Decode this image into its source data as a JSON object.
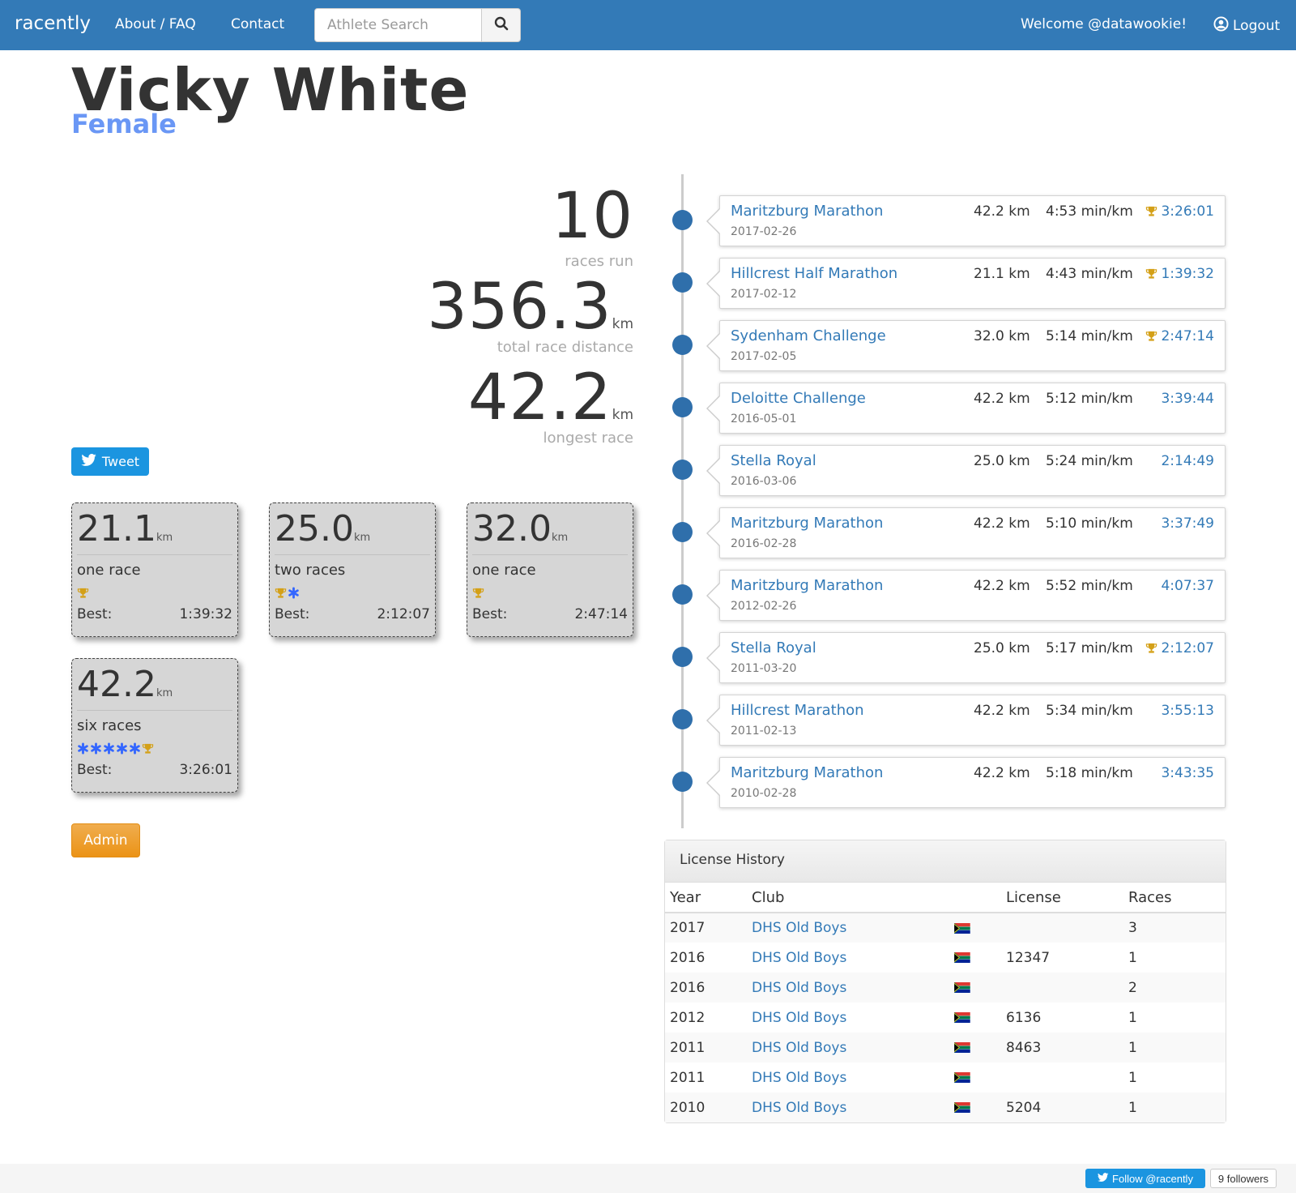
{
  "navbar": {
    "brand": "racently",
    "links": [
      "About / FAQ",
      "Contact"
    ],
    "search": {
      "placeholder": "Athlete Search",
      "button_icon": "search-icon"
    },
    "welcome": "Welcome @datawookie!",
    "logout": "Logout",
    "logout_icon": "user-circle-icon",
    "color": "#337ab7"
  },
  "athlete": {
    "name": "Vicky White",
    "gender": "Female"
  },
  "stats": {
    "races_run": "10",
    "races_run_label": "races run",
    "total_distance": "356.3",
    "total_distance_unit": "km",
    "total_distance_label": "total race distance",
    "longest": "42.2",
    "longest_unit": "km",
    "longest_label": "longest race"
  },
  "tweet_label": "Tweet",
  "distances": [
    {
      "dist": "21.1",
      "unit": "km",
      "count": "one race",
      "icons": [
        "trophy-icon"
      ],
      "best_label": "Best:",
      "best": "1:39:32"
    },
    {
      "dist": "25.0",
      "unit": "km",
      "count": "two races",
      "icons": [
        "trophy-icon",
        "asterisk-icon"
      ],
      "best_label": "Best:",
      "best": "2:12:07"
    },
    {
      "dist": "32.0",
      "unit": "km",
      "count": "one race",
      "icons": [
        "trophy-icon"
      ],
      "best_label": "Best:",
      "best": "2:47:14"
    },
    {
      "dist": "42.2",
      "unit": "km",
      "count": "six races",
      "icons": [
        "asterisk-icon",
        "asterisk-icon",
        "asterisk-icon",
        "asterisk-icon",
        "asterisk-icon",
        "trophy-icon"
      ],
      "best_label": "Best:",
      "best": "3:26:01"
    }
  ],
  "admin_label": "Admin",
  "races": [
    {
      "name": "Maritzburg Marathon",
      "date": "2017-02-26",
      "distance": "42.2 km",
      "pace": "4:53 min/km",
      "time": "3:26:01",
      "trophy": true
    },
    {
      "name": "Hillcrest Half Marathon",
      "date": "2017-02-12",
      "distance": "21.1 km",
      "pace": "4:43 min/km",
      "time": "1:39:32",
      "trophy": true
    },
    {
      "name": "Sydenham Challenge",
      "date": "2017-02-05",
      "distance": "32.0 km",
      "pace": "5:14 min/km",
      "time": "2:47:14",
      "trophy": true
    },
    {
      "name": "Deloitte Challenge",
      "date": "2016-05-01",
      "distance": "42.2 km",
      "pace": "5:12 min/km",
      "time": "3:39:44",
      "trophy": false
    },
    {
      "name": "Stella Royal",
      "date": "2016-03-06",
      "distance": "25.0 km",
      "pace": "5:24 min/km",
      "time": "2:14:49",
      "trophy": false
    },
    {
      "name": "Maritzburg Marathon",
      "date": "2016-02-28",
      "distance": "42.2 km",
      "pace": "5:10 min/km",
      "time": "3:37:49",
      "trophy": false
    },
    {
      "name": "Maritzburg Marathon",
      "date": "2012-02-26",
      "distance": "42.2 km",
      "pace": "5:52 min/km",
      "time": "4:07:37",
      "trophy": false
    },
    {
      "name": "Stella Royal",
      "date": "2011-03-20",
      "distance": "25.0 km",
      "pace": "5:17 min/km",
      "time": "2:12:07",
      "trophy": true
    },
    {
      "name": "Hillcrest Marathon",
      "date": "2011-02-13",
      "distance": "42.2 km",
      "pace": "5:34 min/km",
      "time": "3:55:13",
      "trophy": false
    },
    {
      "name": "Maritzburg Marathon",
      "date": "2010-02-28",
      "distance": "42.2 km",
      "pace": "5:18 min/km",
      "time": "3:43:35",
      "trophy": false
    }
  ],
  "license_history": {
    "title": "License History",
    "columns": [
      "Year",
      "Club",
      "",
      "License",
      "Races"
    ],
    "rows": [
      {
        "year": "2017",
        "club": "DHS Old Boys",
        "flag": "south-africa-flag-icon",
        "license": "",
        "races": "3"
      },
      {
        "year": "2016",
        "club": "DHS Old Boys",
        "flag": "south-africa-flag-icon",
        "license": "12347",
        "races": "1"
      },
      {
        "year": "2016",
        "club": "DHS Old Boys",
        "flag": "south-africa-flag-icon",
        "license": "",
        "races": "2"
      },
      {
        "year": "2012",
        "club": "DHS Old Boys",
        "flag": "south-africa-flag-icon",
        "license": "6136",
        "races": "1"
      },
      {
        "year": "2011",
        "club": "DHS Old Boys",
        "flag": "south-africa-flag-icon",
        "license": "8463",
        "races": "1"
      },
      {
        "year": "2011",
        "club": "DHS Old Boys",
        "flag": "south-africa-flag-icon",
        "license": "",
        "races": "1"
      },
      {
        "year": "2010",
        "club": "DHS Old Boys",
        "flag": "south-africa-flag-icon",
        "license": "5204",
        "races": "1"
      }
    ]
  },
  "footer": {
    "follow_label": "Follow @racently",
    "followers": "9 followers"
  },
  "colors": {
    "primary": "#337ab7",
    "trophy": "#d4a017",
    "asterisk": "#3366ff",
    "admin": "#f0ad4e",
    "timeline_dot": "#2f6fab",
    "gender": "#6a97f5"
  }
}
